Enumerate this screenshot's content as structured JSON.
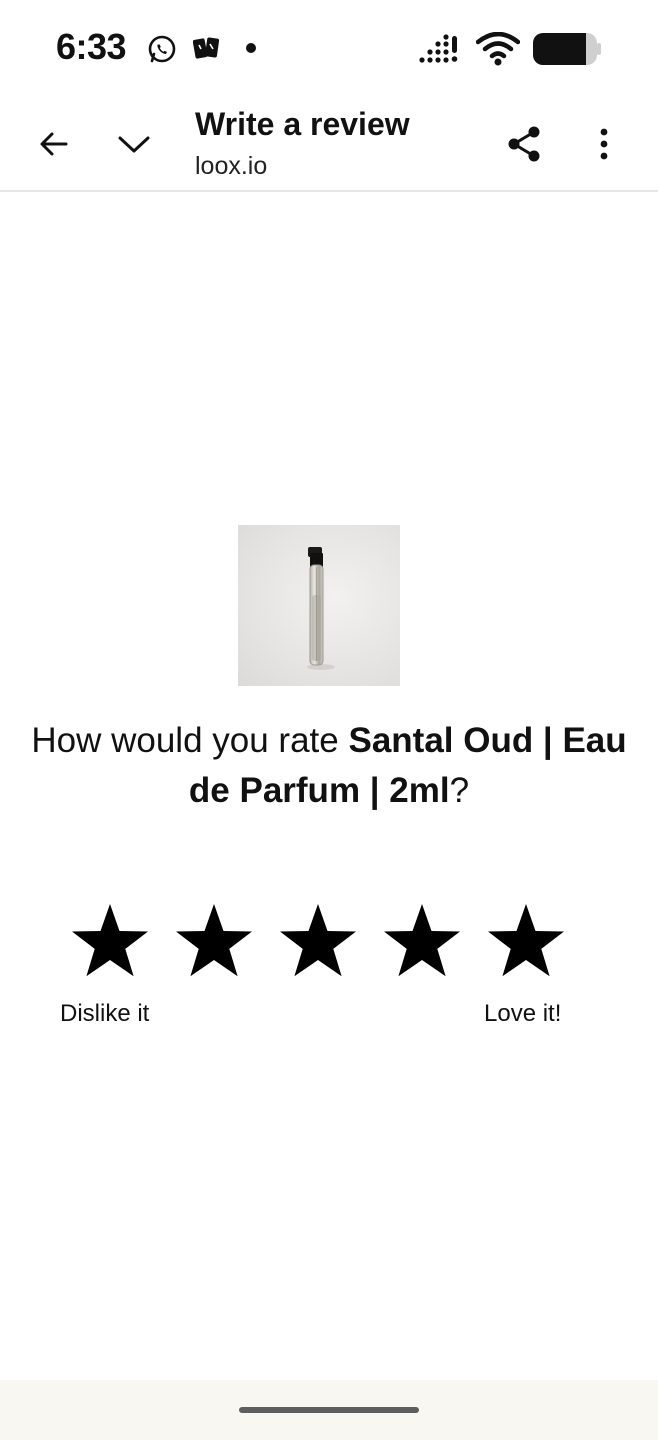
{
  "status_bar": {
    "time": "6:33",
    "icons": [
      "whatsapp-icon",
      "app-notification-icon",
      "dot-icon",
      "signal-icon",
      "wifi-icon",
      "battery-icon"
    ]
  },
  "toolbar": {
    "title": "Write a review",
    "url": "loox.io",
    "icons": [
      "back-arrow-icon",
      "chevron-down-icon",
      "share-icon",
      "more-vert-icon"
    ]
  },
  "review": {
    "question_prefix": "How would you rate ",
    "product_name": "Santal Oud | Eau de Parfum | 2ml",
    "question_suffix": "?",
    "star_count": 5,
    "low_label": "Dislike it",
    "high_label": "Love it!"
  },
  "colors": {
    "text": "#111111",
    "star": "#000000",
    "bottom_bar": "#f8f7f2",
    "divider": "#e6e6e6"
  }
}
